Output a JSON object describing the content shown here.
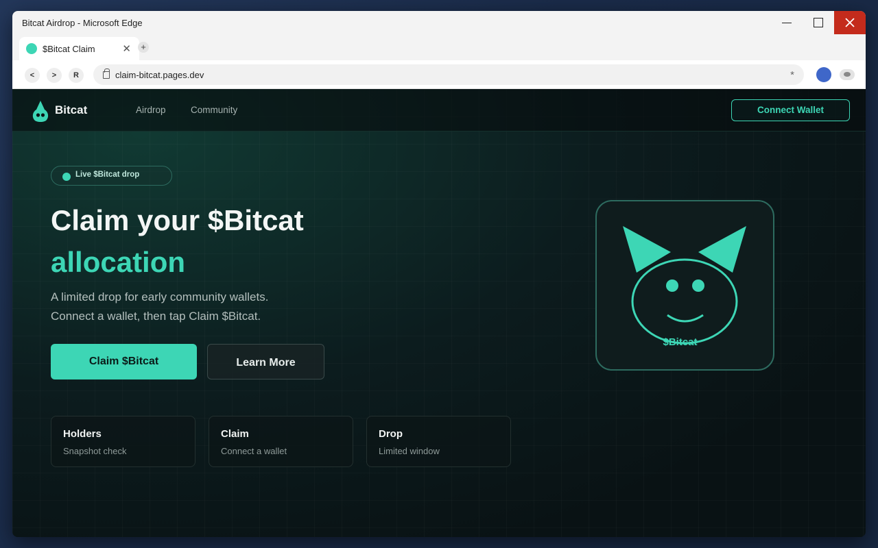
{
  "window": {
    "title": "Bitcat Airdrop - Microsoft Edge"
  },
  "browser": {
    "tab_title": "$Bitcat Claim",
    "tab_close_glyph": "✕",
    "new_tab_glyph": "+",
    "back_label": "<",
    "forward_label": ">",
    "reload_label": "R",
    "url": "claim-bitcat.pages.dev",
    "favorite_glyph": "*"
  },
  "site": {
    "brand": "Bitcat",
    "nav": {
      "airdrop": "Airdrop",
      "community": "Community"
    },
    "connect_wallet": "Connect Wallet"
  },
  "hero": {
    "badge": "Live $Bitcat drop",
    "title_line1": "Claim your $Bitcat",
    "title_line2": "allocation",
    "subtitle_line1": "A limited drop for early community wallets.",
    "subtitle_line2": "Connect a wallet, then tap Claim $Bitcat.",
    "primary_button": "Claim $Bitcat",
    "secondary_button": "Learn More"
  },
  "cards": [
    {
      "title": "Holders",
      "text": "Snapshot check"
    },
    {
      "title": "Claim",
      "text": "Connect a wallet"
    },
    {
      "title": "Drop",
      "text": "Limited window"
    }
  ],
  "mascot": {
    "label": "$Bitcat"
  },
  "colors": {
    "accent": "#3dd6b5",
    "background": "#0b1315",
    "close_button": "#c42b1c",
    "profile": "#3f67c9"
  },
  "icons": {
    "brand": "cat-logo-icon",
    "lock": "lock-icon",
    "profile": "profile-avatar-icon",
    "extension": "eye-extension-icon"
  }
}
